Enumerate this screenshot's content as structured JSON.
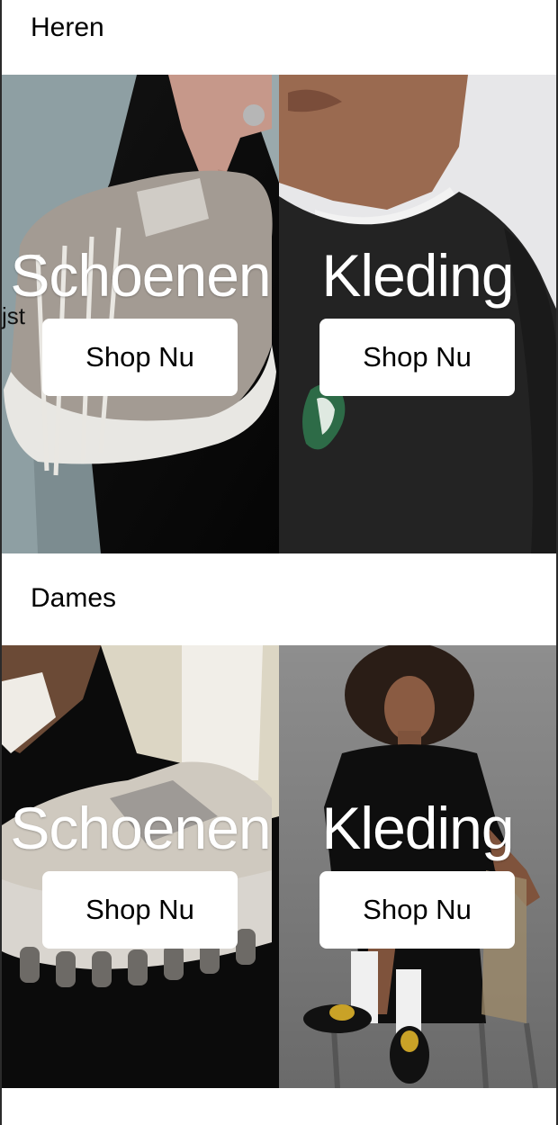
{
  "sections": [
    {
      "title": "Heren",
      "tiles": [
        {
          "heading": "Schoenen",
          "button_label": "Shop Nu",
          "image": "men-sneakers-photo"
        },
        {
          "heading": "Kleding",
          "button_label": "Shop Nu",
          "image": "men-sweatshirt-photo"
        }
      ]
    },
    {
      "title": "Dames",
      "tiles": [
        {
          "heading": "Schoenen",
          "button_label": "Shop Nu",
          "image": "women-sneakers-photo"
        },
        {
          "heading": "Kleding",
          "button_label": "Shop Nu",
          "image": "women-dress-photo"
        }
      ]
    }
  ],
  "stray_text": "jst",
  "colors": {
    "background": "#ffffff",
    "button_bg": "#ffffff",
    "heading_text": "#ffffff",
    "frame_border": "#2b2b2b"
  }
}
